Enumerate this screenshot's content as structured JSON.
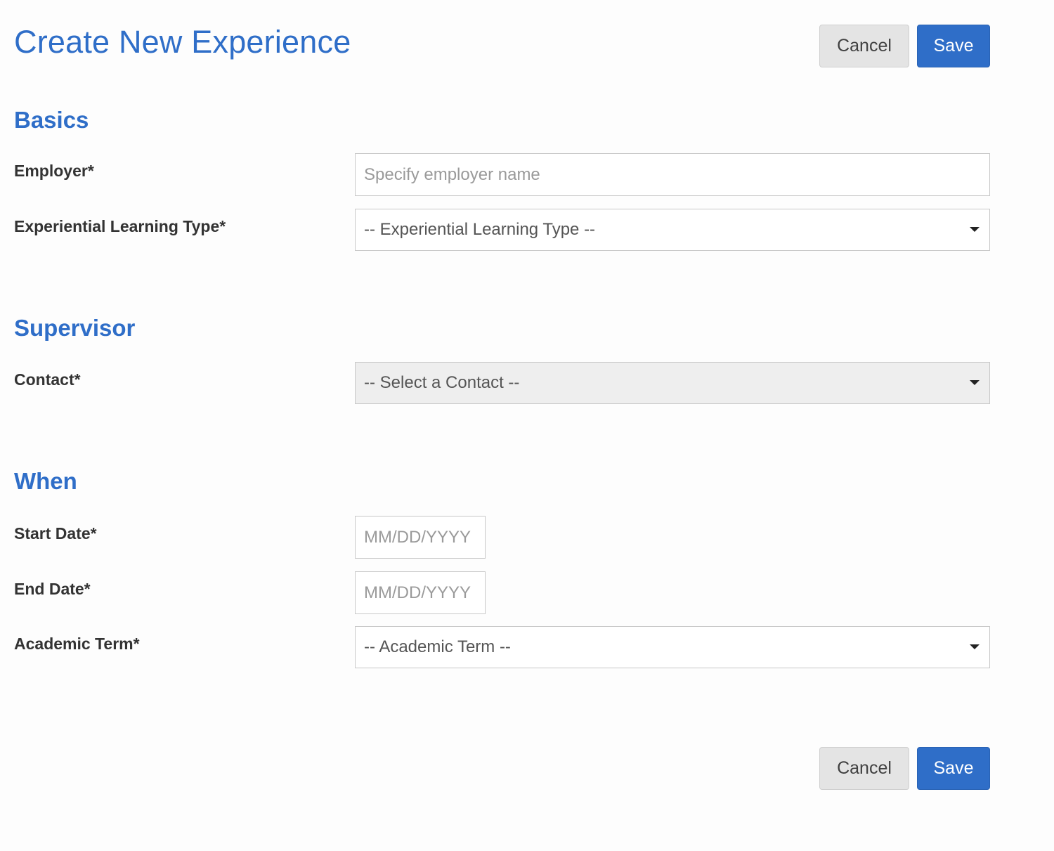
{
  "header": {
    "title": "Create New Experience",
    "cancel_label": "Cancel",
    "save_label": "Save"
  },
  "sections": {
    "basics": {
      "heading": "Basics",
      "employer": {
        "label": "Employer*",
        "value": "",
        "placeholder": "Specify employer name"
      },
      "learning_type": {
        "label": "Experiential Learning Type*",
        "selected": "-- Experiential Learning Type --"
      }
    },
    "supervisor": {
      "heading": "Supervisor",
      "contact": {
        "label": "Contact*",
        "selected": "-- Select a Contact --",
        "disabled": true
      }
    },
    "when": {
      "heading": "When",
      "start_date": {
        "label": "Start Date*",
        "value": "",
        "placeholder": "MM/DD/YYYY"
      },
      "end_date": {
        "label": "End Date*",
        "value": "",
        "placeholder": "MM/DD/YYYY"
      },
      "academic_term": {
        "label": "Academic Term*",
        "selected": "-- Academic Term --"
      }
    }
  },
  "footer": {
    "cancel_label": "Cancel",
    "save_label": "Save"
  },
  "colors": {
    "accent": "#2f6ec8",
    "label_text": "#333333",
    "cancel_bg": "#e4e4e4",
    "disabled_bg": "#eeeeee"
  },
  "icons": {
    "dropdown": "caret-down-icon"
  }
}
